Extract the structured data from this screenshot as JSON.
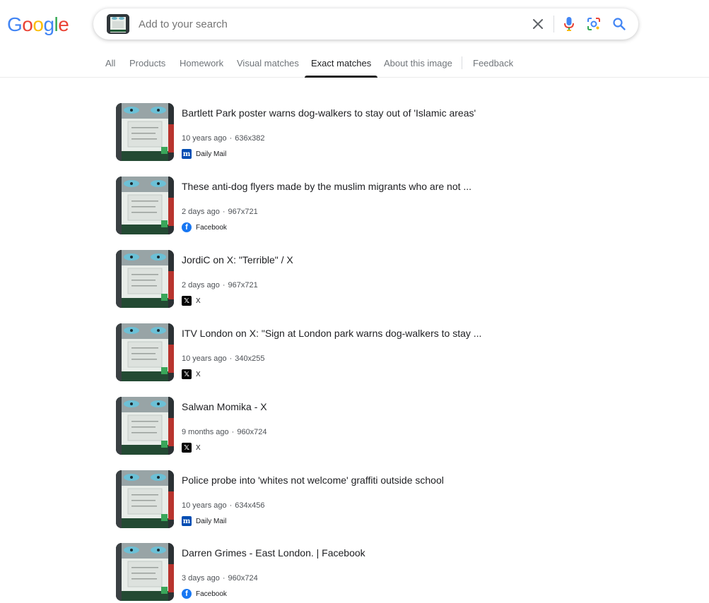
{
  "logo": {
    "letters": [
      "G",
      "o",
      "o",
      "g",
      "l",
      "e"
    ]
  },
  "search": {
    "placeholder": "Add to your search"
  },
  "tabs": [
    {
      "label": "All"
    },
    {
      "label": "Products"
    },
    {
      "label": "Homework"
    },
    {
      "label": "Visual matches"
    },
    {
      "label": "Exact matches",
      "active": true
    },
    {
      "label": "About this image"
    },
    {
      "label": "Feedback"
    }
  ],
  "results": [
    {
      "title": "Bartlett Park poster warns dog-walkers to stay out of 'Islamic areas'",
      "age": "10 years ago",
      "size": "636x382",
      "source": "Daily Mail",
      "source_icon": "daily-mail-icon"
    },
    {
      "title": "These anti-dog flyers made by the muslim migrants who are not ...",
      "age": "2 days ago",
      "size": "967x721",
      "source": "Facebook",
      "source_icon": "facebook-icon"
    },
    {
      "title": "JordiC on X: \"Terrible\" / X",
      "age": "2 days ago",
      "size": "967x721",
      "source": "X",
      "source_icon": "x-icon"
    },
    {
      "title": "ITV London on X: \"Sign at London park warns dog-walkers to stay ...",
      "age": "10 years ago",
      "size": "340x255",
      "source": "X",
      "source_icon": "x-icon"
    },
    {
      "title": "Salwan Momika - X",
      "age": "9 months ago",
      "size": "960x724",
      "source": "X",
      "source_icon": "x-icon"
    },
    {
      "title": "Police probe into 'whites not welcome' graffiti outside school",
      "age": "10 years ago",
      "size": "634x456",
      "source": "Daily Mail",
      "source_icon": "daily-mail-icon"
    },
    {
      "title": "Darren Grimes - East London. | Facebook",
      "age": "3 days ago",
      "size": "960x724",
      "source": "Facebook",
      "source_icon": "facebook-icon"
    }
  ],
  "colors": {
    "google_blue": "#4285f4",
    "google_red": "#ea4335",
    "google_yellow": "#fbbc05",
    "google_green": "#34a853",
    "daily_mail": "#004db3",
    "facebook": "#1877f2"
  }
}
